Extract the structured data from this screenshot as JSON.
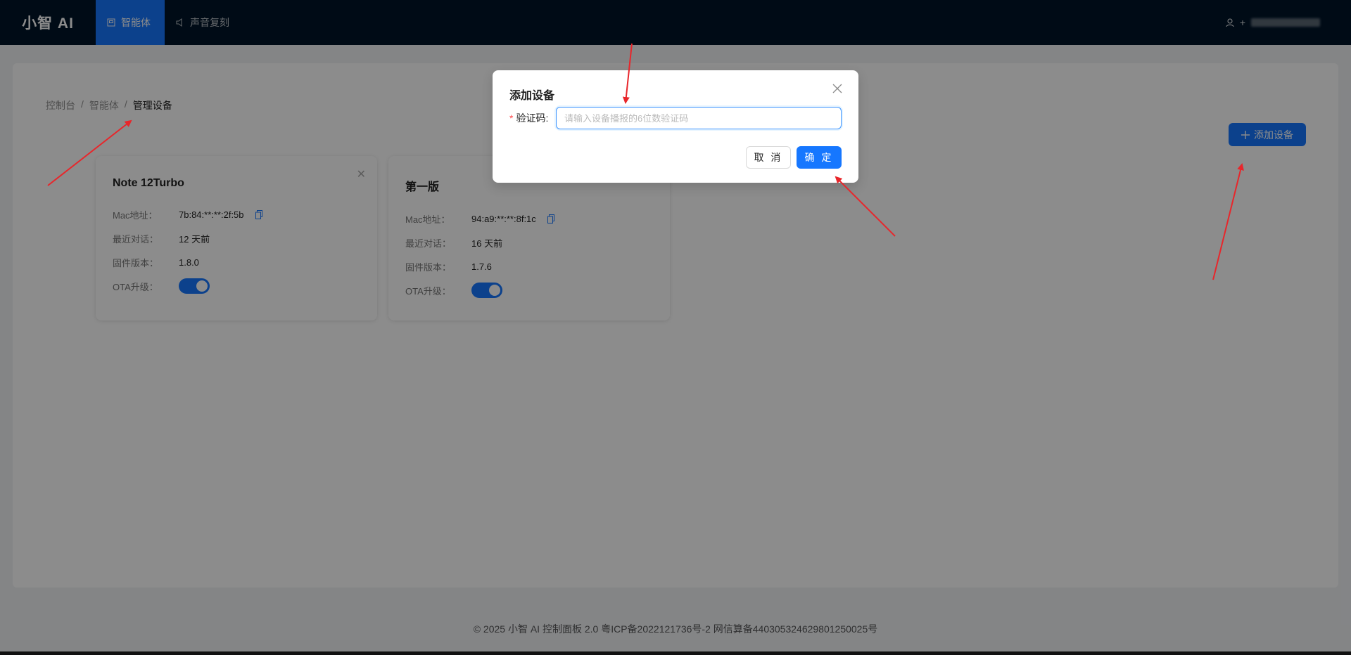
{
  "app": {
    "logo": "小智 AI"
  },
  "nav": {
    "items": [
      {
        "label": "智能体",
        "active": true
      },
      {
        "label": "声音复刻",
        "active": false
      }
    ],
    "user_prefix": "+"
  },
  "breadcrumb": [
    "控制台",
    "智能体",
    "管理设备"
  ],
  "breadcrumb_sep": "/",
  "toolbar": {
    "add_device_label": "添加设备"
  },
  "devices": [
    {
      "name": "Note 12Turbo",
      "mac_label": "Mac地址：",
      "mac": "7b:84:**:**:2f:5b",
      "last_chat_label": "最近对话：",
      "last_chat": "12 天前",
      "firmware_label": "固件版本：",
      "firmware": "1.8.0",
      "ota_label": "OTA升级：",
      "ota_enabled": true
    },
    {
      "name": "第一版",
      "mac_label": "Mac地址：",
      "mac": "94:a9:**:**:8f:1c",
      "last_chat_label": "最近对话：",
      "last_chat": "16 天前",
      "firmware_label": "固件版本：",
      "firmware": "1.7.6",
      "ota_label": "OTA升级：",
      "ota_enabled": true
    }
  ],
  "footer": "© 2025 小智 AI 控制面板 2.0 粤ICP备2022121736号-2 网信算备440305324629801250025号",
  "modal": {
    "title": "添加设备",
    "field_label": "验证码:",
    "field_required": "*",
    "placeholder": "请输入设备播报的6位数验证码",
    "value": "",
    "cancel_label": "取 消",
    "ok_label": "确 定"
  },
  "colors": {
    "primary": "#1677ff",
    "nav_bg": "#001529",
    "annotation": "#e8262b"
  }
}
